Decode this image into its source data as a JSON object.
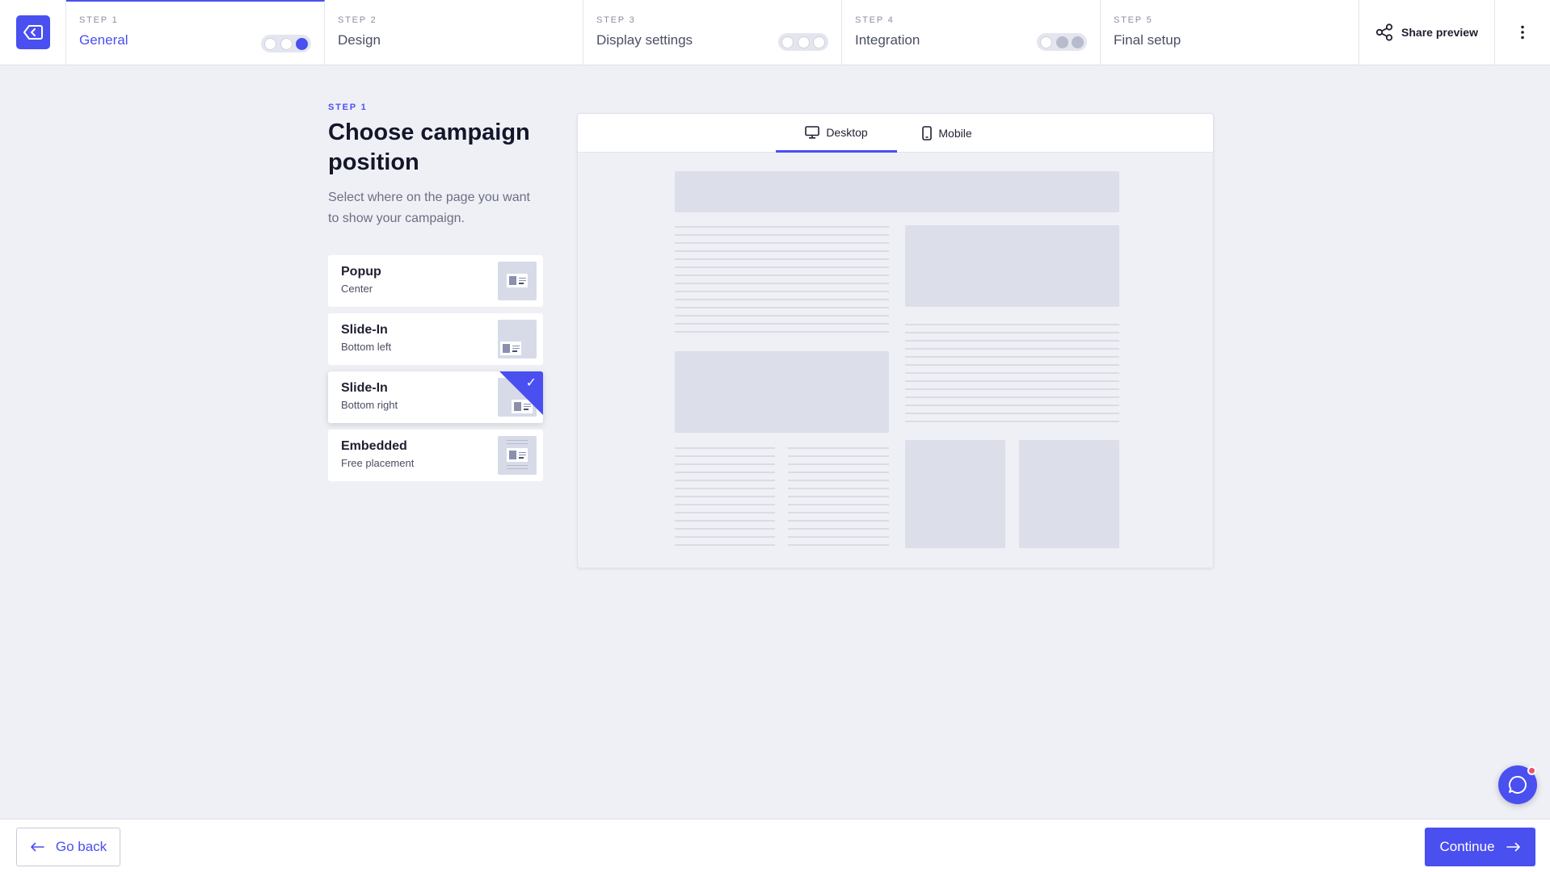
{
  "steps": [
    {
      "num": "STEP 1",
      "name": "General"
    },
    {
      "num": "STEP 2",
      "name": "Design"
    },
    {
      "num": "STEP 3",
      "name": "Display settings"
    },
    {
      "num": "STEP 4",
      "name": "Integration"
    },
    {
      "num": "STEP 5",
      "name": "Final setup"
    }
  ],
  "header": {
    "share_label": "Share preview"
  },
  "main": {
    "eyebrow": "STEP 1",
    "title": "Choose campaign position",
    "subtitle": "Select where on the page you want to show your campaign.",
    "options": [
      {
        "title": "Popup",
        "subtitle": "Center"
      },
      {
        "title": "Slide-In",
        "subtitle": "Bottom left"
      },
      {
        "title": "Slide-In",
        "subtitle": "Bottom right",
        "selected": true
      },
      {
        "title": "Embedded",
        "subtitle": "Free placement"
      }
    ]
  },
  "preview": {
    "tabs": [
      {
        "label": "Desktop",
        "active": true
      },
      {
        "label": "Mobile"
      }
    ]
  },
  "footer": {
    "back_label": "Go back",
    "continue_label": "Continue"
  },
  "colors": {
    "accent": "#4a4ff0",
    "background": "#eff0f5",
    "notification": "#f0506e"
  }
}
